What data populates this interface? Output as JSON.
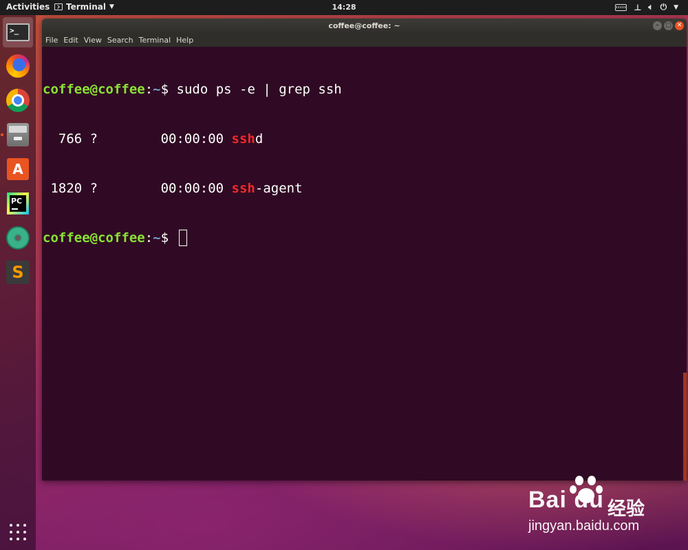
{
  "topbar": {
    "activities": "Activities",
    "app_menu": "Terminal",
    "clock": "14:28",
    "tray_icons": [
      "keyboard-icon",
      "network-icon",
      "volume-icon",
      "power-icon"
    ]
  },
  "dock": {
    "items": [
      {
        "name": "terminal",
        "icon": "terminal-icon",
        "active": true
      },
      {
        "name": "firefox",
        "icon": "firefox-icon"
      },
      {
        "name": "chrome",
        "icon": "chrome-icon"
      },
      {
        "name": "files",
        "icon": "files-icon",
        "running": true
      },
      {
        "name": "ubuntu-software",
        "icon": "software-icon",
        "glyph": "A"
      },
      {
        "name": "pycharm",
        "icon": "pycharm-icon",
        "glyph": "PC"
      },
      {
        "name": "atom",
        "icon": "atom-icon"
      },
      {
        "name": "sublime-text",
        "icon": "sublime-icon",
        "glyph": "S"
      }
    ],
    "show_apps": "apps-grid-icon"
  },
  "window": {
    "title": "coffee@coffee: ~",
    "menu": [
      "File",
      "Edit",
      "View",
      "Search",
      "Terminal",
      "Help"
    ],
    "terminal": {
      "prompt_user": "coffee@coffee",
      "prompt_sep": ":",
      "prompt_path": "~",
      "prompt_symbol": "$ ",
      "command": "sudo ps -e | grep ssh",
      "output": [
        {
          "pid": "  766",
          "tty": " ?        ",
          "time": "00:00:00 ",
          "match": "ssh",
          "rest": "d"
        },
        {
          "pid": " 1820",
          "tty": " ?        ",
          "time": "00:00:00 ",
          "match": "ssh",
          "rest": "-agent"
        }
      ]
    }
  },
  "watermark": {
    "logo": "Bai du",
    "cn": "经验",
    "url": "jingyan.baidu.com"
  },
  "colors": {
    "terminal_bg": "#300a24",
    "prompt_user": "#8ae234",
    "prompt_path": "#729fcf",
    "grep_match": "#ef2929",
    "ubuntu_orange": "#e95420"
  }
}
